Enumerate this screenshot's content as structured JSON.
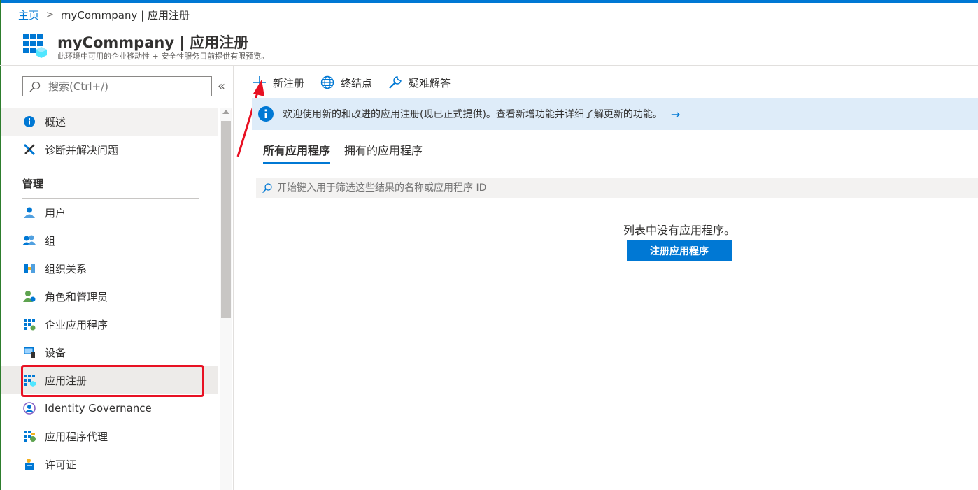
{
  "breadcrumb": {
    "home": "主页",
    "separator": ">",
    "current": "myCommpany | 应用注册"
  },
  "header": {
    "title": "myCommpany | 应用注册",
    "subtitle": "此环境中可用的企业移动性 + 安全性服务目前提供有限预览。"
  },
  "sidebar": {
    "search_placeholder": "搜索(Ctrl+/)",
    "collapse": "«",
    "items_top": [
      {
        "label": "概述"
      },
      {
        "label": "诊断并解决问题"
      }
    ],
    "section_manage": "管理",
    "items_manage": [
      {
        "label": "用户"
      },
      {
        "label": "组"
      },
      {
        "label": "组织关系"
      },
      {
        "label": "角色和管理员"
      },
      {
        "label": "企业应用程序"
      },
      {
        "label": "设备"
      },
      {
        "label": "应用注册"
      },
      {
        "label": "Identity Governance"
      },
      {
        "label": "应用程序代理"
      },
      {
        "label": "许可证"
      }
    ]
  },
  "toolbar": {
    "new_registration": "新注册",
    "endpoints": "终结点",
    "troubleshoot": "疑难解答"
  },
  "banner": {
    "text": "欢迎使用新的和改进的应用注册(现已正式提供)。查看新增功能并详细了解更新的功能。",
    "arrow": "→"
  },
  "tabs": [
    {
      "label": "所有应用程序"
    },
    {
      "label": "拥有的应用程序"
    }
  ],
  "filter": {
    "placeholder": "开始键入用于筛选这些结果的名称或应用程序 ID"
  },
  "empty_state": {
    "message": "列表中没有应用程序。",
    "button": "注册应用程序"
  },
  "colors": {
    "accent": "#0078d4",
    "banner_bg": "#deecf9",
    "highlight": "#e81123"
  }
}
